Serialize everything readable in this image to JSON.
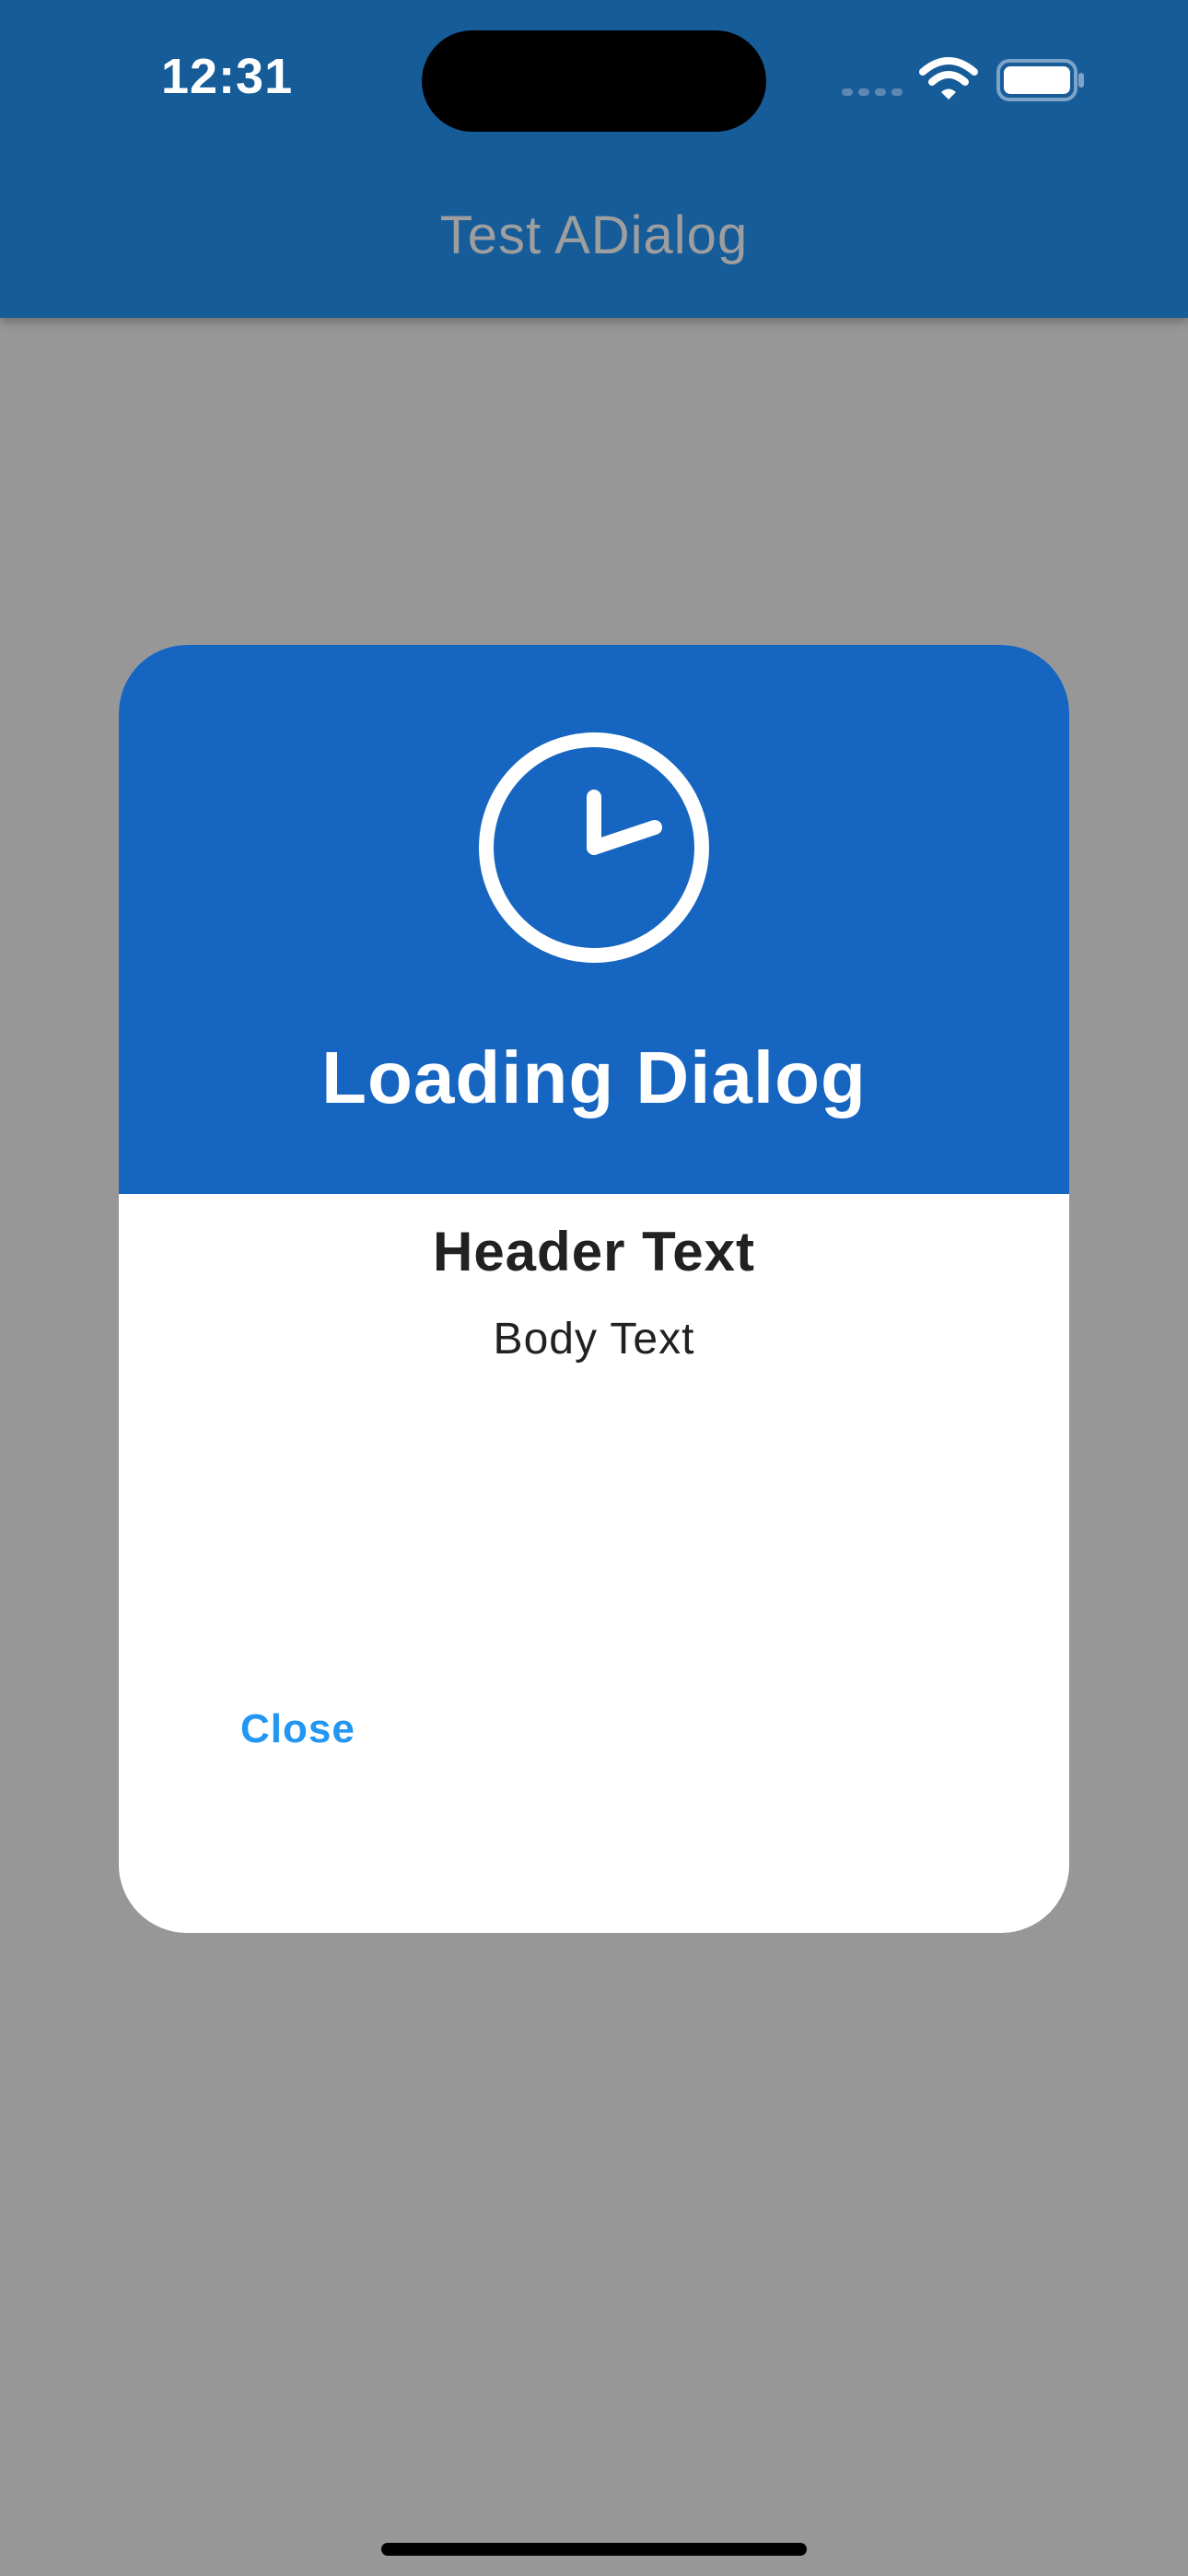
{
  "status_bar": {
    "time": "12:31",
    "icons": [
      "signal-icon",
      "wifi-icon",
      "battery-icon"
    ]
  },
  "app_bar": {
    "title": "Test ADialog"
  },
  "dialog": {
    "icon": "clock-icon",
    "title": "Loading Dialog",
    "header_text": "Header Text",
    "body_text": "Body Text",
    "close_label": "Close"
  },
  "colors": {
    "app_bar": "#165c99",
    "dialog_header": "#1665c0",
    "scrim": "#979797",
    "close_button": "#2196f3"
  }
}
